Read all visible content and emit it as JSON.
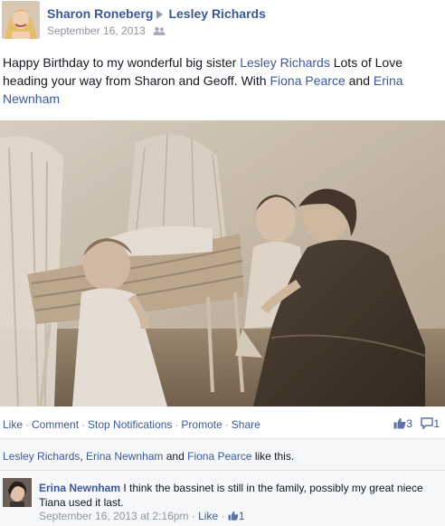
{
  "post": {
    "author": "Sharon Roneberg",
    "recipient": "Lesley Richards",
    "date": "September 16, 2013",
    "text_part1": "Happy Birthday to my wonderful big sister ",
    "text_link1": "Lesley Richards",
    "text_part2": " Lots of Love heading your way from Sharon and Geoff. With ",
    "text_link2": "Fiona Pearce",
    "text_part3": " and ",
    "text_link3": "Erina Newnham"
  },
  "actions": {
    "like": "Like",
    "comment": "Comment",
    "stop_notifications": "Stop Notifications",
    "promote": "Promote",
    "share": "Share",
    "separator": "·",
    "like_count": "3",
    "comment_count": "1"
  },
  "likes": {
    "name1": "Lesley Richards",
    "sep1": ", ",
    "name2": "Erina Newnham",
    "sep2": " and ",
    "name3": "Fiona Pearce",
    "suffix": " like this."
  },
  "comment": {
    "author": "Erina Newnham",
    "text": " I think the bassinet is still in the family, possibly my great niece Tiana used it last.",
    "timestamp": "September 16, 2013 at 2:16pm",
    "sep": " · ",
    "like_label": "Like",
    "sep2": " · ",
    "like_count": "1"
  },
  "colors": {
    "link": "#3b5998",
    "muted": "#90949c",
    "panel": "#f6f7f9"
  },
  "icons": [
    "audience-icon",
    "thumbs-up-icon",
    "comment-icon"
  ]
}
